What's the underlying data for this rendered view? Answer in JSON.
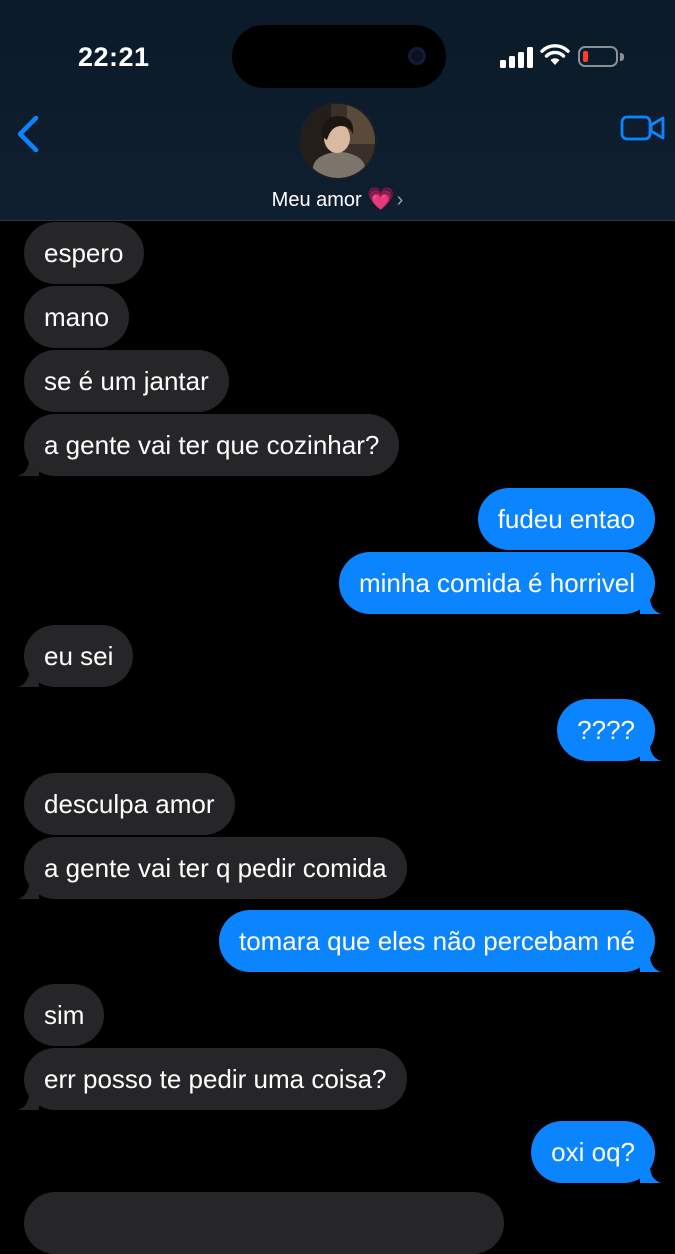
{
  "status_bar": {
    "time": "22:21"
  },
  "header": {
    "contact_name": "Meu amor",
    "heart": "💗",
    "chevron": "›"
  },
  "colors": {
    "incoming": "#262628",
    "outgoing": "#0a84ff",
    "accent": "#0a84ff",
    "battery_low": "#ff3b30"
  },
  "icons": {
    "back": "chevron-left-icon",
    "video": "video-camera-icon"
  },
  "messages": [
    {
      "from": "them",
      "text": "espero"
    },
    {
      "from": "them",
      "text": "mano"
    },
    {
      "from": "them",
      "text": "se é um jantar"
    },
    {
      "from": "them",
      "text": "a gente vai ter que cozinhar?"
    },
    {
      "from": "me",
      "text": "fudeu entao"
    },
    {
      "from": "me",
      "text": "minha comida é horrivel"
    },
    {
      "from": "them",
      "text": "eu sei"
    },
    {
      "from": "me",
      "text": "????"
    },
    {
      "from": "them",
      "text": "desculpa amor"
    },
    {
      "from": "them",
      "text": "a gente vai ter q pedir comida"
    },
    {
      "from": "me",
      "text": "tomara que eles não percebam né"
    },
    {
      "from": "them",
      "text": "sim"
    },
    {
      "from": "them",
      "text": "err posso te pedir uma coisa?"
    },
    {
      "from": "me",
      "text": "oxi oq?"
    }
  ]
}
